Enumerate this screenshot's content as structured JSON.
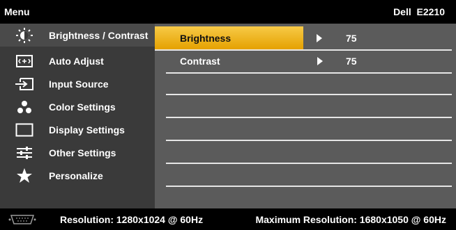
{
  "header": {
    "title": "Menu",
    "model": "Dell  E2210"
  },
  "sidebar": {
    "items": [
      {
        "label": "Brightness / Contrast",
        "icon": "brightness-icon"
      },
      {
        "label": "Auto Adjust",
        "icon": "auto-adjust-icon"
      },
      {
        "label": "Input Source",
        "icon": "input-source-icon"
      },
      {
        "label": "Color Settings",
        "icon": "color-settings-icon"
      },
      {
        "label": "Display Settings",
        "icon": "display-settings-icon"
      },
      {
        "label": "Other Settings",
        "icon": "other-settings-icon"
      },
      {
        "label": "Personalize",
        "icon": "star-icon"
      }
    ]
  },
  "content": {
    "rows": [
      {
        "label": "Brightness",
        "value": "75"
      },
      {
        "label": "Contrast",
        "value": "75"
      }
    ]
  },
  "footer": {
    "resolution": "Resolution: 1280x1024 @ 60Hz",
    "max_resolution": "Maximum Resolution: 1680x1050 @ 60Hz"
  },
  "colors": {
    "highlight_top": "#f7ca47",
    "highlight_bottom": "#e5a100",
    "sidebar_bg": "#3a3a3a",
    "content_bg": "#5b5b5b"
  }
}
